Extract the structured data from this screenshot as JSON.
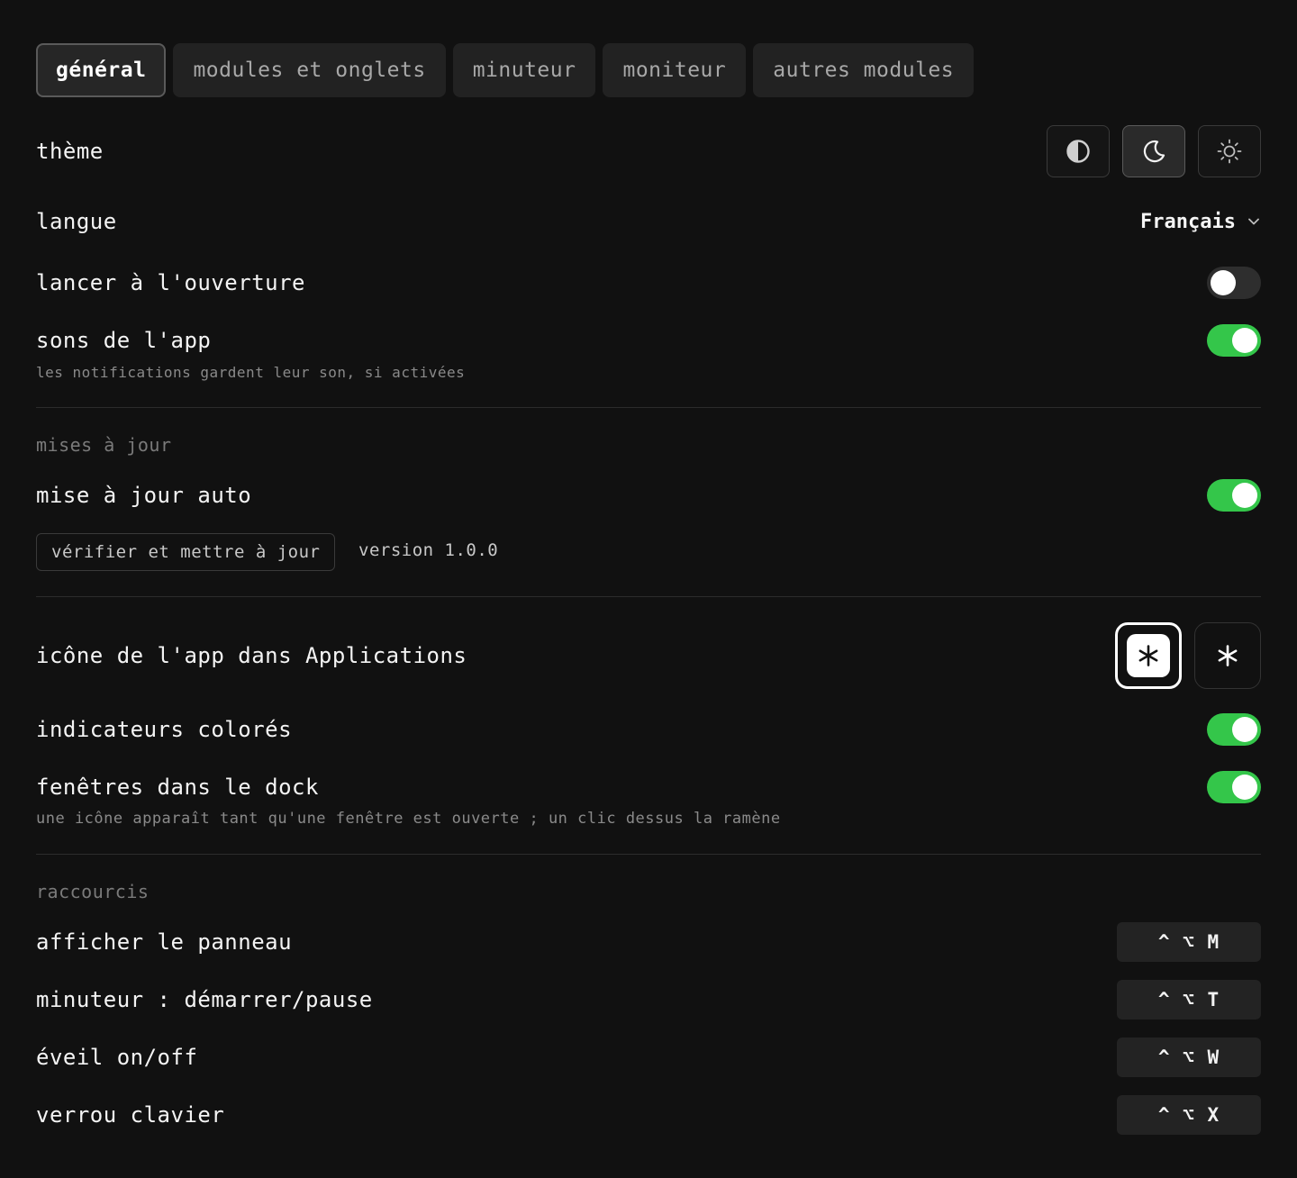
{
  "tabs": [
    {
      "label": "général",
      "active": true
    },
    {
      "label": "modules et onglets",
      "active": false
    },
    {
      "label": "minuteur",
      "active": false
    },
    {
      "label": "moniteur",
      "active": false
    },
    {
      "label": "autres modules",
      "active": false
    }
  ],
  "general": {
    "theme_label": "thème",
    "theme_options": [
      "contrast-icon",
      "moon-icon",
      "sun-icon"
    ],
    "theme_selected": "moon-icon",
    "language_label": "langue",
    "language_value": "Français",
    "launch_label": "lancer à l'ouverture",
    "launch_on": false,
    "sounds_label": "sons de l'app",
    "sounds_on": true,
    "sounds_hint": "les notifications gardent leur son, si activées"
  },
  "updates": {
    "section_title": "mises à jour",
    "auto_label": "mise à jour auto",
    "auto_on": true,
    "check_button": "vérifier et mettre à jour",
    "version": "version 1.0.0"
  },
  "appearance": {
    "app_icon_label": "icône de l'app dans Applications",
    "app_icon_options": [
      "light",
      "dark"
    ],
    "app_icon_selected": "light",
    "colored_label": "indicateurs colorés",
    "colored_on": true,
    "dock_label": "fenêtres dans le dock",
    "dock_on": true,
    "dock_hint": "une icône apparaît tant qu'une fenêtre est ouverte ; un clic dessus la ramène"
  },
  "shortcuts": {
    "section_title": "raccourcis",
    "items": [
      {
        "label": "afficher le panneau",
        "keys": "^ ⌥ M"
      },
      {
        "label": "minuteur : démarrer/pause",
        "keys": "^ ⌥ T"
      },
      {
        "label": "éveil on/off",
        "keys": "^ ⌥ W"
      },
      {
        "label": "verrou clavier",
        "keys": "^ ⌥ X"
      }
    ]
  },
  "colors": {
    "background": "#111111",
    "toggle_on": "#34c64a",
    "toggle_off": "#2e2e2e"
  }
}
